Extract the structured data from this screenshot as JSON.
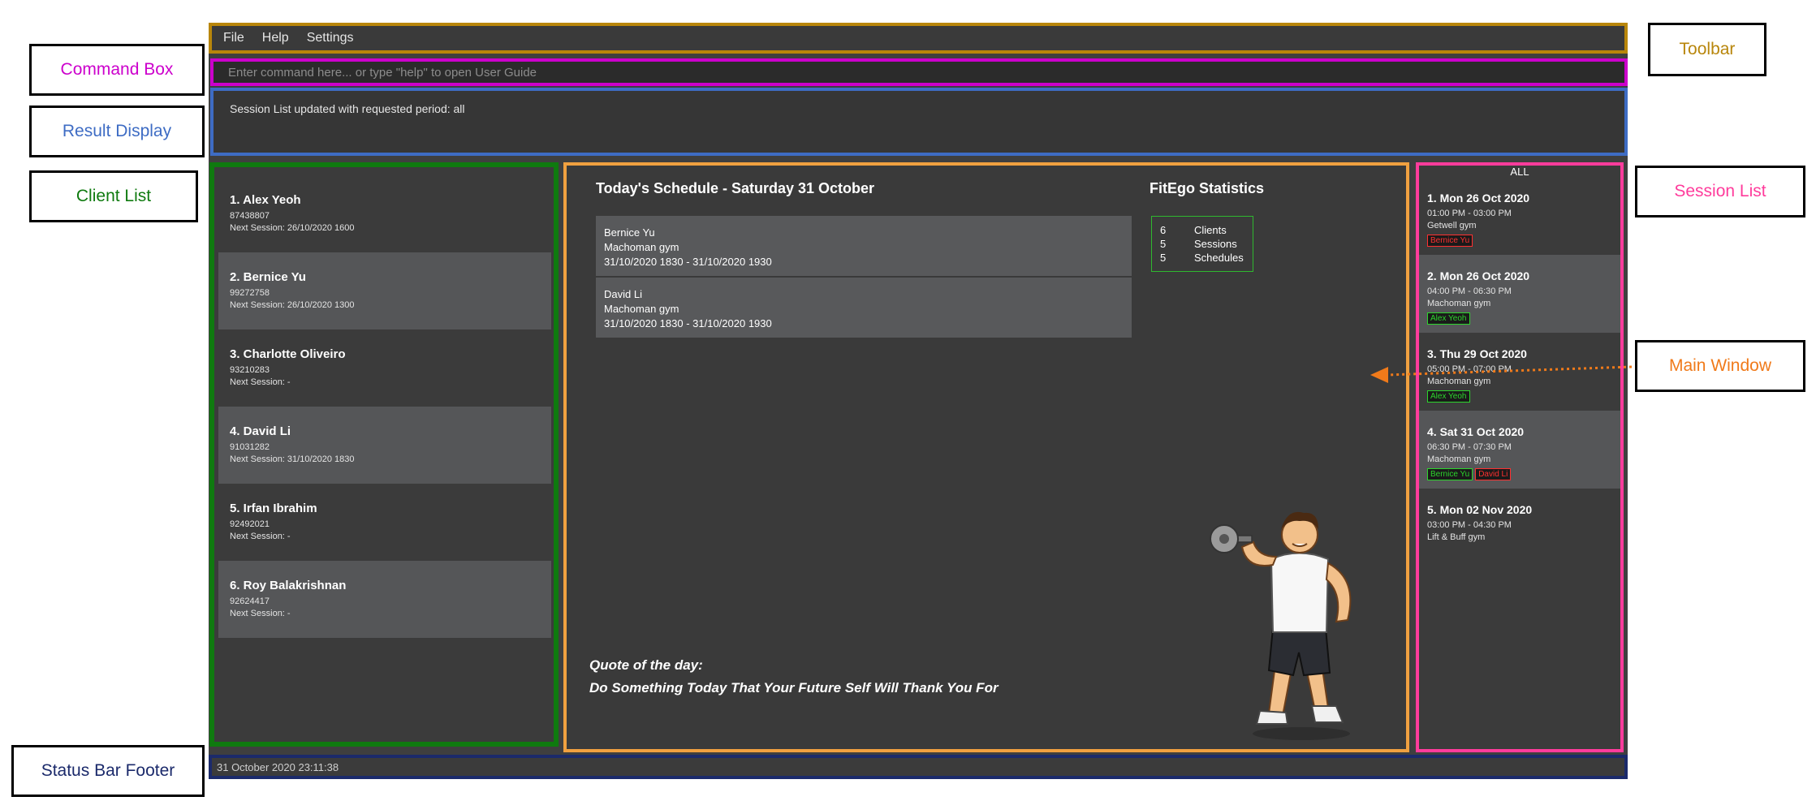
{
  "toolbar": {
    "menu": [
      "File",
      "Help",
      "Settings"
    ]
  },
  "command_box": {
    "placeholder": "Enter command here... or type \"help\" to open User Guide",
    "value": ""
  },
  "result_display": {
    "text": "Session List updated with requested period: all"
  },
  "client_list": [
    {
      "title": "1.  Alex Yeoh",
      "phone": "87438807",
      "next_session": "Next Session: 26/10/2020 1600"
    },
    {
      "title": "2.  Bernice Yu",
      "phone": "99272758",
      "next_session": "Next Session: 26/10/2020 1300"
    },
    {
      "title": "3.  Charlotte Oliveiro",
      "phone": "93210283",
      "next_session": "Next Session:  -"
    },
    {
      "title": "4.  David Li",
      "phone": "91031282",
      "next_session": "Next Session: 31/10/2020 1830"
    },
    {
      "title": "5.  Irfan Ibrahim",
      "phone": "92492021",
      "next_session": "Next Session:  -"
    },
    {
      "title": "6.  Roy Balakrishnan",
      "phone": "92624417",
      "next_session": "Next Session:  -"
    }
  ],
  "main": {
    "schedule_title": "Today's Schedule - Saturday 31 October",
    "schedules": [
      {
        "client": "Bernice Yu",
        "gym": "Machoman gym",
        "period": "31/10/2020 1830 - 31/10/2020 1930"
      },
      {
        "client": "David Li",
        "gym": "Machoman gym",
        "period": "31/10/2020 1830 - 31/10/2020 1930"
      }
    ],
    "stats_title": "FitEgo Statistics",
    "stats": [
      {
        "count": "6",
        "label": "Clients"
      },
      {
        "count": "5",
        "label": "Sessions"
      },
      {
        "count": "5",
        "label": "Schedules"
      }
    ],
    "quote_label": "Quote of the day:",
    "quote": "Do Something Today That Your Future Self Will Thank You For",
    "mascot_icon": "bodybuilder-mascot-icon"
  },
  "session_list": {
    "header": "ALL",
    "sessions": [
      {
        "title": "1.  Mon 26 Oct 2020",
        "time": "01:00 PM - 03:00 PM",
        "gym": "Getwell gym",
        "tags": [
          {
            "text": "Bernice Yu",
            "color": "red"
          }
        ]
      },
      {
        "title": "2.  Mon 26 Oct 2020",
        "time": "04:00 PM - 06:30 PM",
        "gym": "Machoman gym",
        "tags": [
          {
            "text": "Alex Yeoh",
            "color": "green"
          }
        ]
      },
      {
        "title": "3.  Thu 29 Oct 2020",
        "time": "05:00 PM - 07:00 PM",
        "gym": "Machoman gym",
        "tags": [
          {
            "text": "Alex Yeoh",
            "color": "green"
          }
        ]
      },
      {
        "title": "4.  Sat 31 Oct 2020",
        "time": "06:30 PM - 07:30 PM",
        "gym": "Machoman gym",
        "tags": [
          {
            "text": "Bernice Yu",
            "color": "green"
          },
          {
            "text": "David Li",
            "color": "red"
          }
        ]
      },
      {
        "title": "5.  Mon 02 Nov 2020",
        "time": "03:00 PM - 04:30 PM",
        "gym": "Lift & Buff gym",
        "tags": []
      }
    ]
  },
  "status_bar": {
    "text": "31 October 2020 23:11:38"
  },
  "annotations": {
    "toolbar": "Toolbar",
    "command_box": "Command Box",
    "result_display": "Result Display",
    "client_list": "Client List",
    "session_list": "Session List",
    "main_window": "Main Window",
    "status_bar": "Status Bar Footer"
  },
  "colors": {
    "toolbar": "#b8860b",
    "command_box": "#cc00cc",
    "result_display": "#3e6cc4",
    "client_list": "#0f7a0f",
    "main_window": "#f0a040",
    "session_list": "#ff3c9c",
    "status_bar": "#1b2a6b"
  }
}
